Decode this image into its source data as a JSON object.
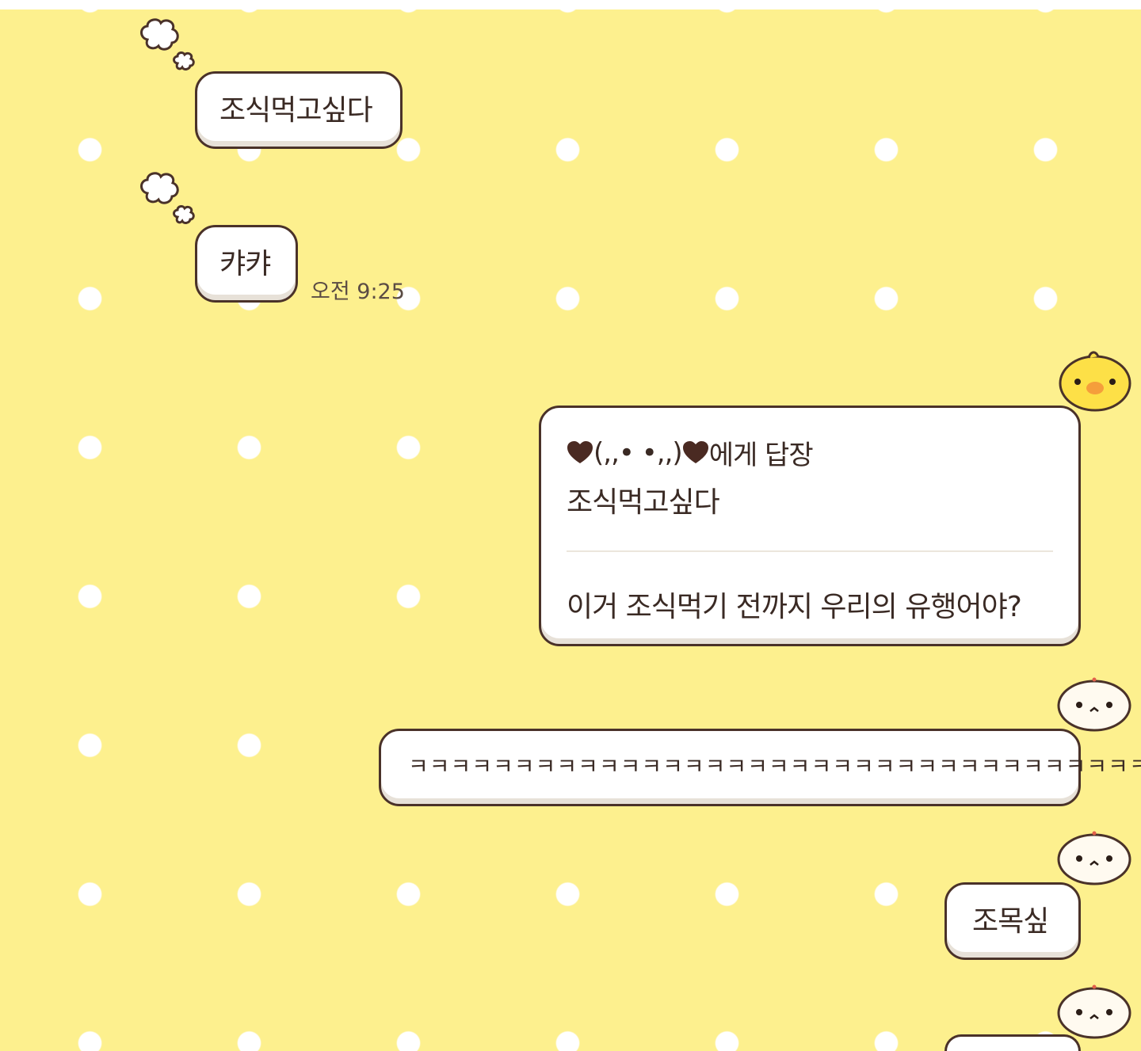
{
  "messages": [
    {
      "text": "조식먹고싶다"
    },
    {
      "text": "캬캬",
      "time": "오전 9:25"
    }
  ],
  "reply": {
    "to_name": "(,,• •,,)",
    "reply_label": "에게 답장",
    "quoted": "조식먹고싶다",
    "text": "이거 조식먹기 전까지 우리의 유행어야?"
  },
  "my_messages": [
    {
      "text": "ㅋㅋㅋㅋㅋㅋㅋㅋㅋㅋㅋㅋㅋㅋㅋㅋㅋㅋㅋㅋㅋㅋㅋㅋㅋㅋㅋㅋㅋㅋㅋㅋㅋㅋㅋ"
    },
    {
      "text": "조목싶"
    }
  ],
  "icons": {
    "cloud": "thought-cloud-icon",
    "heart": "heart-icon",
    "chick_avatar": "chick-avatar-icon",
    "dumpling_avatar": "dumpling-avatar-icon"
  },
  "colors": {
    "background": "#fdf08e",
    "dots": "#ffffff",
    "bubble_border": "#4a3229",
    "text": "#3a2a24",
    "chick": "#fde047"
  }
}
